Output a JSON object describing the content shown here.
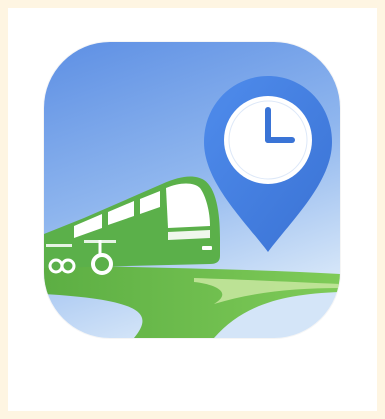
{
  "app_icon": {
    "name": "bus-tracker-app-icon",
    "colors": {
      "background_top": "#6d9be8",
      "background_bottom": "#c5dcf7",
      "bus": "#5bb04a",
      "bus_window": "#ffffff",
      "road": "#6cc04f",
      "road_light": "#b8e08e",
      "pin": "#4a86e8",
      "pin_dark": "#3a74d6",
      "clock_face": "#ffffff",
      "clock_hands": "#3a74d6"
    }
  }
}
